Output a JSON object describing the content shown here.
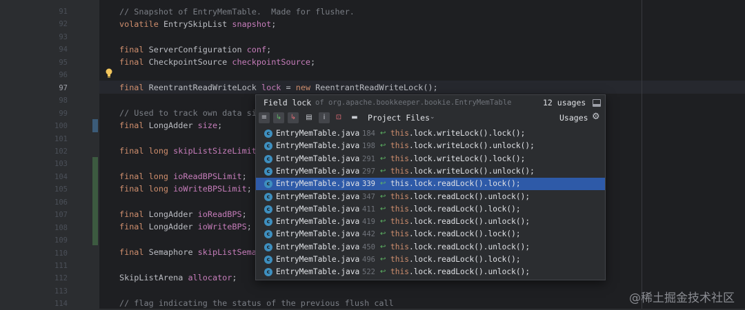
{
  "gutter": {
    "line_numbers": [
      "91",
      "92",
      "93",
      "94",
      "95",
      "96",
      "97",
      "98",
      "99",
      "100",
      "101",
      "102",
      "103",
      "104",
      "105",
      "106",
      "107",
      "108",
      "109",
      "110",
      "111",
      "112",
      "113",
      "114"
    ]
  },
  "code": {
    "l91": "// Snapshot of EntryMemTable.  Made for flusher.",
    "l92_kw": "volatile",
    "l92_type": "EntrySkipList",
    "l92_field": "snapshot",
    "l94_kw": "final",
    "l94_type": "ServerConfiguration",
    "l94_field": "conf",
    "l95_kw": "final",
    "l95_type": "CheckpointSource",
    "l95_field": "checkpointSource",
    "l97_kw": "final",
    "l97_type": "ReentrantReadWriteLock",
    "l97_field": "lock",
    "l97_new": "new",
    "l97_ctor": "ReentrantReadWriteLock();",
    "l99": "// Used to track own data size",
    "l100_kw": "final",
    "l100_type": "LongAdder",
    "l100_field": "size",
    "l102_kw": "final long",
    "l102_field": "skipListSizeLimit",
    "l104_kw": "final long",
    "l104_field": "ioReadBPSLimit",
    "l105_kw": "final long",
    "l105_field": "ioWriteBPSLimit",
    "l107_kw": "final",
    "l107_type": "LongAdder",
    "l107_field": "ioReadBPS",
    "l108_kw": "final",
    "l108_type": "LongAdder",
    "l108_field": "ioWriteBPS",
    "l110_kw": "final",
    "l110_type": "Semaphore",
    "l110_field": "skipListSemaph",
    "l112_type": "SkipListArena",
    "l112_field": "allocator",
    "l114": "// flag indicating the status of the previous flush call",
    "semicolon": ";"
  },
  "popup": {
    "title": "Field lock",
    "of_text": "of org.apache.bookkeeper.bookie.EntryMemTable",
    "count": "12 usages",
    "scope": "Project Files",
    "usages_label": "Usages",
    "this_kw": "this",
    "rows": [
      {
        "file": "EntryMemTable.java",
        "line": "184",
        "code": ".lock.writeLock().lock();",
        "selected": false
      },
      {
        "file": "EntryMemTable.java",
        "line": "198",
        "code": ".lock.writeLock().unlock();",
        "selected": false
      },
      {
        "file": "EntryMemTable.java",
        "line": "291",
        "code": ".lock.writeLock().lock();",
        "selected": false
      },
      {
        "file": "EntryMemTable.java",
        "line": "297",
        "code": ".lock.writeLock().unlock();",
        "selected": false
      },
      {
        "file": "EntryMemTable.java",
        "line": "339",
        "code": ".lock.readLock().lock();",
        "selected": true
      },
      {
        "file": "EntryMemTable.java",
        "line": "347",
        "code": ".lock.readLock().unlock();",
        "selected": false
      },
      {
        "file": "EntryMemTable.java",
        "line": "411",
        "code": ".lock.readLock().lock();",
        "selected": false
      },
      {
        "file": "EntryMemTable.java",
        "line": "419",
        "code": ".lock.readLock().unlock();",
        "selected": false
      },
      {
        "file": "EntryMemTable.java",
        "line": "442",
        "code": ".lock.readLock().lock();",
        "selected": false
      },
      {
        "file": "EntryMemTable.java",
        "line": "450",
        "code": ".lock.readLock().unlock();",
        "selected": false
      },
      {
        "file": "EntryMemTable.java",
        "line": "496",
        "code": ".lock.readLock().lock();",
        "selected": false
      },
      {
        "file": "EntryMemTable.java",
        "line": "522",
        "code": ".lock.readLock().unlock();",
        "selected": false
      }
    ]
  },
  "watermark": "@稀土掘金技术社区",
  "colors": {
    "editor_bg": "#1e1f22",
    "keyword": "#cf8e6d",
    "field": "#c77dbb",
    "comment": "#7a7e85",
    "selection": "#2e5aa8"
  }
}
